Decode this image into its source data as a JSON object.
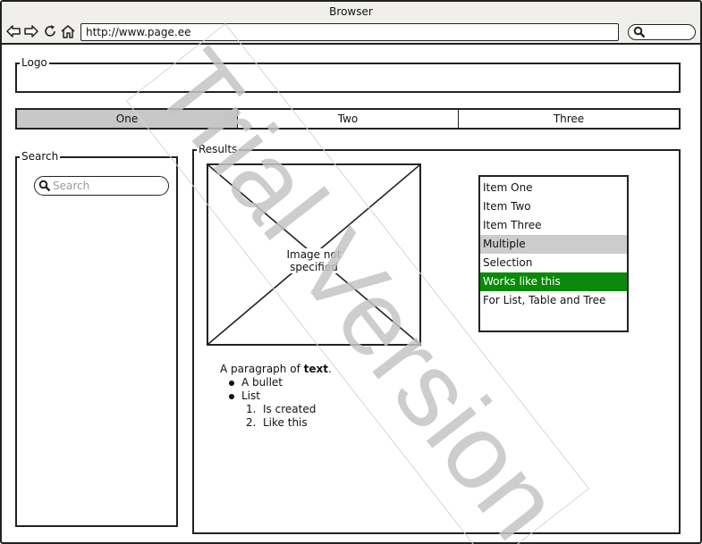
{
  "window": {
    "title": "Browser"
  },
  "toolbar": {
    "back_icon": "back-arrow-icon",
    "forward_icon": "forward-arrow-icon",
    "reload_icon": "reload-icon",
    "home_icon": "home-icon",
    "url": "http://www.page.ee",
    "search_icon": "search-icon"
  },
  "logo": {
    "label": "Logo"
  },
  "tabs": [
    {
      "label": "One",
      "active": true
    },
    {
      "label": "Two",
      "active": false
    },
    {
      "label": "Three",
      "active": false
    }
  ],
  "search": {
    "label": "Search",
    "placeholder": "Search"
  },
  "results": {
    "label": "Results",
    "image_caption": "Image not specified",
    "list_items": [
      {
        "label": "Item One",
        "state": "normal"
      },
      {
        "label": "Item Two",
        "state": "normal"
      },
      {
        "label": "Item Three",
        "state": "normal"
      },
      {
        "label": "Multiple",
        "state": "selected-grey"
      },
      {
        "label": "Selection",
        "state": "normal"
      },
      {
        "label": "Works like this",
        "state": "selected-green"
      },
      {
        "label": "For List, Table and Tree",
        "state": "normal"
      }
    ],
    "paragraph_prefix": "A paragraph of ",
    "paragraph_bold": "text",
    "paragraph_suffix": ".",
    "bullets": [
      "A bullet",
      "List"
    ],
    "numbered": [
      "Is created",
      "Like this"
    ]
  },
  "watermark": "Trial Version",
  "colors": {
    "selected_green": "#0a8a0a",
    "selected_grey": "#cccccc",
    "active_tab": "#c8c8c8"
  }
}
